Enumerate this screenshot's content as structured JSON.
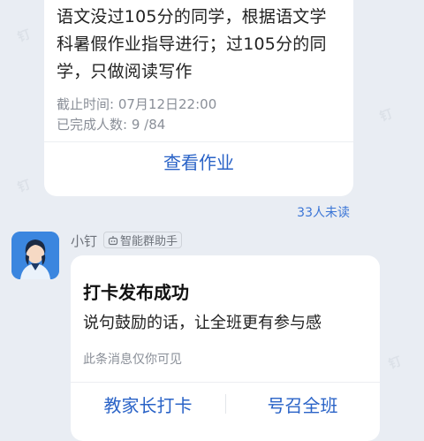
{
  "assignment_card": {
    "message": "语文没过105分的同学，根据语文学科暑假作业指导进行；过105分的同学，只做阅读写作",
    "deadline_label": "截止时间:",
    "deadline_value": "07月12日22:00",
    "completed_label": "已完成人数:",
    "completed_value": "9 /84",
    "view_button": "查看作业",
    "unread": "33人未读"
  },
  "second_message": {
    "sender": "小钉",
    "badge": "智能群助手",
    "card_title": "打卡发布成功",
    "card_body": "说句鼓励的话，让全班更有参与感",
    "card_note": "此条消息仅你可见",
    "btn_parent": "教家长打卡",
    "btn_call": "号召全班"
  },
  "colors": {
    "link_blue": "#2a63c7",
    "background": "#e9edf3",
    "card": "#ffffff",
    "avatar_bg": "#3b86df"
  }
}
